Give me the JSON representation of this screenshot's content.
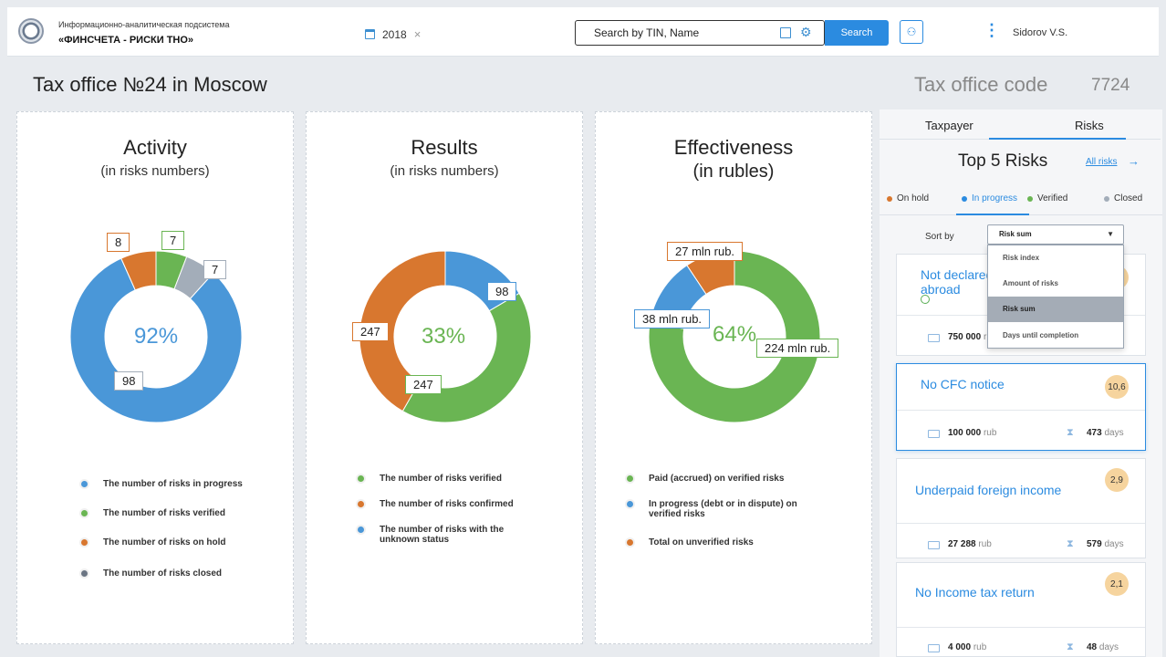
{
  "header": {
    "brand_small": "Информационно-аналитическая подсистема",
    "brand_main": "«ФИНСЧЕТА - РИСКИ ТНО»",
    "year": "2018",
    "search_placeholder": "Search by TIN, Name",
    "search_label": "Search",
    "user": "Sidorov V.S."
  },
  "page": {
    "title": "Tax office №24 in Moscow",
    "code_label": "Tax office code",
    "code_value": "7724"
  },
  "colors": {
    "blue": "#4a97d8",
    "green": "#6ab553",
    "orange": "#d8772f",
    "gray": "#a3adb9",
    "accent": "#2b8be0"
  },
  "charts": [
    {
      "title": "Activity",
      "subtitle": "(in risks numbers)",
      "center_label": "92%",
      "center_color": "#4a97d8",
      "callouts": [
        "8",
        "7",
        "7",
        "98"
      ],
      "legend": [
        "The number of risks in progress",
        "The number of risks verified",
        "The number of risks on hold",
        "The number of risks closed"
      ]
    },
    {
      "title": "Results",
      "subtitle": "(in risks numbers)",
      "center_label": "33%",
      "center_color": "#6ab553",
      "callouts": [
        "98",
        "247",
        "247"
      ],
      "legend": [
        "The number of risks verified",
        "The number of risks confirmed",
        "The number of risks with the unknown status"
      ]
    },
    {
      "title": "Effectiveness",
      "subtitle": "(in rubles)",
      "center_label": "64%",
      "center_color": "#6ab553",
      "callouts": [
        "27 mln rub.",
        "38 mln rub.",
        "224 mln rub."
      ],
      "legend": [
        "Paid (accrued) on verified risks",
        "In progress (debt or in dispute) on verified risks",
        "Total on unverified risks"
      ]
    }
  ],
  "chart_data": [
    {
      "type": "pie",
      "title": "Activity",
      "categories": [
        "In progress",
        "Verified",
        "On hold",
        "Closed"
      ],
      "values": [
        98,
        7,
        8,
        7
      ],
      "colors": [
        "#4a97d8",
        "#6ab553",
        "#d8772f",
        "#a3adb9"
      ]
    },
    {
      "type": "pie",
      "title": "Results",
      "categories": [
        "Verified",
        "Confirmed",
        "Unknown status"
      ],
      "values": [
        247,
        247,
        98
      ],
      "colors": [
        "#6ab553",
        "#d8772f",
        "#4a97d8"
      ]
    },
    {
      "type": "pie",
      "title": "Effectiveness",
      "categories": [
        "Paid (accrued) on verified risks",
        "In progress on verified risks",
        "Total on unverified risks"
      ],
      "values": [
        224,
        38,
        27
      ],
      "colors": [
        "#6ab553",
        "#4a97d8",
        "#d8772f"
      ]
    }
  ],
  "panel": {
    "tabs": [
      "Taxpayer",
      "Risks"
    ],
    "heading": "Top 5 Risks",
    "all_risks": "All risks",
    "statuses": [
      "On hold",
      "In progress",
      "Verified",
      "Closed"
    ],
    "sort_label": "Sort by",
    "sort_value": "Risk sum",
    "sort_options": [
      "Risk index",
      "Amount of risks",
      "Risk sum",
      "Days until completion"
    ],
    "risks": [
      {
        "title": "Not declared abroad",
        "badge": "1",
        "amount": "750 000",
        "unit": "r",
        "days": "",
        "days_unit": ""
      },
      {
        "title": "No CFC notice",
        "badge": "10,6",
        "amount": "100 000",
        "unit": "rub",
        "days": "473",
        "days_unit": "days"
      },
      {
        "title": "Underpaid foreign income",
        "badge": "2,9",
        "amount": "27 288",
        "unit": "rub",
        "days": "579",
        "days_unit": "days"
      },
      {
        "title": "No Income tax return",
        "badge": "2,1",
        "amount": "4 000",
        "unit": "rub",
        "days": "48",
        "days_unit": "days"
      }
    ]
  }
}
